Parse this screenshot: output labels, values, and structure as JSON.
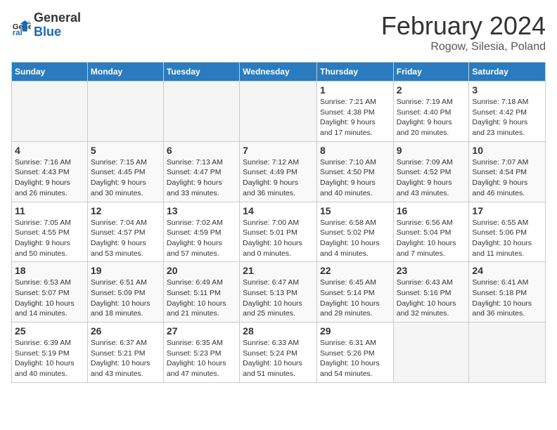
{
  "header": {
    "logo_general": "General",
    "logo_blue": "Blue",
    "main_title": "February 2024",
    "subtitle": "Rogow, Silesia, Poland"
  },
  "weekdays": [
    "Sunday",
    "Monday",
    "Tuesday",
    "Wednesday",
    "Thursday",
    "Friday",
    "Saturday"
  ],
  "weeks": [
    [
      {
        "day": "",
        "info": "",
        "empty": true
      },
      {
        "day": "",
        "info": "",
        "empty": true
      },
      {
        "day": "",
        "info": "",
        "empty": true
      },
      {
        "day": "",
        "info": "",
        "empty": true
      },
      {
        "day": "1",
        "info": "Sunrise: 7:21 AM\nSunset: 4:38 PM\nDaylight: 9 hours\nand 17 minutes."
      },
      {
        "day": "2",
        "info": "Sunrise: 7:19 AM\nSunset: 4:40 PM\nDaylight: 9 hours\nand 20 minutes."
      },
      {
        "day": "3",
        "info": "Sunrise: 7:18 AM\nSunset: 4:42 PM\nDaylight: 9 hours\nand 23 minutes."
      }
    ],
    [
      {
        "day": "4",
        "info": "Sunrise: 7:16 AM\nSunset: 4:43 PM\nDaylight: 9 hours\nand 26 minutes."
      },
      {
        "day": "5",
        "info": "Sunrise: 7:15 AM\nSunset: 4:45 PM\nDaylight: 9 hours\nand 30 minutes."
      },
      {
        "day": "6",
        "info": "Sunrise: 7:13 AM\nSunset: 4:47 PM\nDaylight: 9 hours\nand 33 minutes."
      },
      {
        "day": "7",
        "info": "Sunrise: 7:12 AM\nSunset: 4:49 PM\nDaylight: 9 hours\nand 36 minutes."
      },
      {
        "day": "8",
        "info": "Sunrise: 7:10 AM\nSunset: 4:50 PM\nDaylight: 9 hours\nand 40 minutes."
      },
      {
        "day": "9",
        "info": "Sunrise: 7:09 AM\nSunset: 4:52 PM\nDaylight: 9 hours\nand 43 minutes."
      },
      {
        "day": "10",
        "info": "Sunrise: 7:07 AM\nSunset: 4:54 PM\nDaylight: 9 hours\nand 46 minutes."
      }
    ],
    [
      {
        "day": "11",
        "info": "Sunrise: 7:05 AM\nSunset: 4:55 PM\nDaylight: 9 hours\nand 50 minutes."
      },
      {
        "day": "12",
        "info": "Sunrise: 7:04 AM\nSunset: 4:57 PM\nDaylight: 9 hours\nand 53 minutes."
      },
      {
        "day": "13",
        "info": "Sunrise: 7:02 AM\nSunset: 4:59 PM\nDaylight: 9 hours\nand 57 minutes."
      },
      {
        "day": "14",
        "info": "Sunrise: 7:00 AM\nSunset: 5:01 PM\nDaylight: 10 hours\nand 0 minutes."
      },
      {
        "day": "15",
        "info": "Sunrise: 6:58 AM\nSunset: 5:02 PM\nDaylight: 10 hours\nand 4 minutes."
      },
      {
        "day": "16",
        "info": "Sunrise: 6:56 AM\nSunset: 5:04 PM\nDaylight: 10 hours\nand 7 minutes."
      },
      {
        "day": "17",
        "info": "Sunrise: 6:55 AM\nSunset: 5:06 PM\nDaylight: 10 hours\nand 11 minutes."
      }
    ],
    [
      {
        "day": "18",
        "info": "Sunrise: 6:53 AM\nSunset: 5:07 PM\nDaylight: 10 hours\nand 14 minutes."
      },
      {
        "day": "19",
        "info": "Sunrise: 6:51 AM\nSunset: 5:09 PM\nDaylight: 10 hours\nand 18 minutes."
      },
      {
        "day": "20",
        "info": "Sunrise: 6:49 AM\nSunset: 5:11 PM\nDaylight: 10 hours\nand 21 minutes."
      },
      {
        "day": "21",
        "info": "Sunrise: 6:47 AM\nSunset: 5:13 PM\nDaylight: 10 hours\nand 25 minutes."
      },
      {
        "day": "22",
        "info": "Sunrise: 6:45 AM\nSunset: 5:14 PM\nDaylight: 10 hours\nand 29 minutes."
      },
      {
        "day": "23",
        "info": "Sunrise: 6:43 AM\nSunset: 5:16 PM\nDaylight: 10 hours\nand 32 minutes."
      },
      {
        "day": "24",
        "info": "Sunrise: 6:41 AM\nSunset: 5:18 PM\nDaylight: 10 hours\nand 36 minutes."
      }
    ],
    [
      {
        "day": "25",
        "info": "Sunrise: 6:39 AM\nSunset: 5:19 PM\nDaylight: 10 hours\nand 40 minutes."
      },
      {
        "day": "26",
        "info": "Sunrise: 6:37 AM\nSunset: 5:21 PM\nDaylight: 10 hours\nand 43 minutes."
      },
      {
        "day": "27",
        "info": "Sunrise: 6:35 AM\nSunset: 5:23 PM\nDaylight: 10 hours\nand 47 minutes."
      },
      {
        "day": "28",
        "info": "Sunrise: 6:33 AM\nSunset: 5:24 PM\nDaylight: 10 hours\nand 51 minutes."
      },
      {
        "day": "29",
        "info": "Sunrise: 6:31 AM\nSunset: 5:26 PM\nDaylight: 10 hours\nand 54 minutes."
      },
      {
        "day": "",
        "info": "",
        "empty": true
      },
      {
        "day": "",
        "info": "",
        "empty": true
      }
    ]
  ]
}
